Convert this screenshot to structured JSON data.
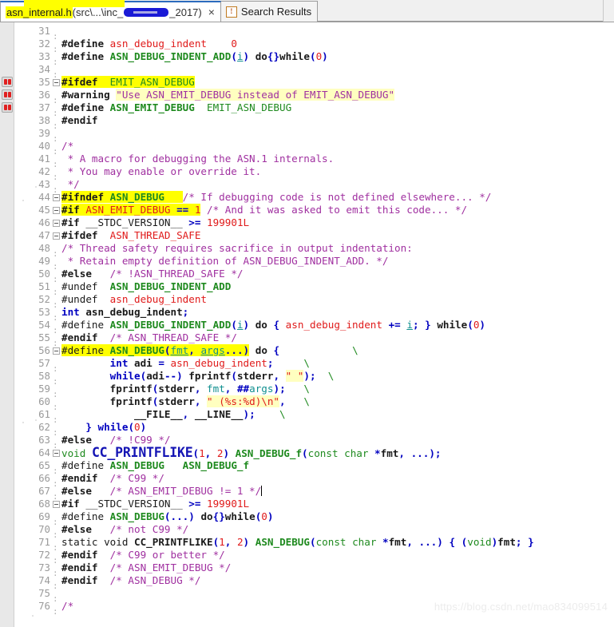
{
  "window": {
    "tabs": [
      {
        "name": "asn_internal.h",
        "path_prefix": "(src\\...\\inc_",
        "path_suffix": "_2017)",
        "close_label": "×",
        "active": true,
        "highlighted_name": true
      },
      {
        "name": "Search Results",
        "icon": "search-results-icon",
        "icon_glyph": "!",
        "active": false
      }
    ]
  },
  "editor": {
    "language": "c-header",
    "first_line": 31,
    "last_line": 76,
    "bookmark_lines": [
      35,
      36,
      37
    ],
    "fold_lines": [
      35,
      44,
      45,
      46,
      47,
      56,
      64,
      68
    ],
    "caret_line": 67,
    "lines": [
      {
        "n": 31,
        "text": ""
      },
      {
        "n": 32,
        "text": "#define asn_debug_indent    0"
      },
      {
        "n": 33,
        "text": "#define ASN_DEBUG_INDENT_ADD(i) do{}while(0)"
      },
      {
        "n": 34,
        "text": ""
      },
      {
        "n": 35,
        "text": "#ifdef  EMIT_ASN_DEBUG"
      },
      {
        "n": 36,
        "text": "#warning \"Use ASN_EMIT_DEBUG instead of EMIT_ASN_DEBUG\""
      },
      {
        "n": 37,
        "text": "#define ASN_EMIT_DEBUG  EMIT_ASN_DEBUG"
      },
      {
        "n": 38,
        "text": "#endif"
      },
      {
        "n": 39,
        "text": ""
      },
      {
        "n": 40,
        "text": "/*"
      },
      {
        "n": 41,
        "text": " * A macro for debugging the ASN.1 internals."
      },
      {
        "n": 42,
        "text": " * You may enable or override it."
      },
      {
        "n": 43,
        "text": " */"
      },
      {
        "n": 44,
        "text": "#ifndef ASN_DEBUG   /* If debugging code is not defined elsewhere... */"
      },
      {
        "n": 45,
        "text": "#if ASN_EMIT_DEBUG == 1 /* And it was asked to emit this code... */"
      },
      {
        "n": 46,
        "text": "#if __STDC_VERSION__ >= 199901L"
      },
      {
        "n": 47,
        "text": "#ifdef  ASN_THREAD_SAFE"
      },
      {
        "n": 48,
        "text": "/* Thread safety requires sacrifice in output indentation:"
      },
      {
        "n": 49,
        "text": " * Retain empty definition of ASN_DEBUG_INDENT_ADD. */"
      },
      {
        "n": 50,
        "text": "#else   /* !ASN_THREAD_SAFE */"
      },
      {
        "n": 51,
        "text": "#undef  ASN_DEBUG_INDENT_ADD"
      },
      {
        "n": 52,
        "text": "#undef  asn_debug_indent"
      },
      {
        "n": 53,
        "text": "int asn_debug_indent;"
      },
      {
        "n": 54,
        "text": "#define ASN_DEBUG_INDENT_ADD(i) do { asn_debug_indent += i; } while(0)"
      },
      {
        "n": 55,
        "text": "#endif  /* ASN_THREAD_SAFE */"
      },
      {
        "n": 56,
        "text": "#define ASN_DEBUG(fmt, args...) do {            \\"
      },
      {
        "n": 57,
        "text": "        int adi = asn_debug_indent;     \\"
      },
      {
        "n": 58,
        "text": "        while(adi--) fprintf(stderr, \" \");  \\"
      },
      {
        "n": 59,
        "text": "        fprintf(stderr, fmt, ##args);   \\"
      },
      {
        "n": 60,
        "text": "        fprintf(stderr, \" (%s:%d)\\n\",   \\"
      },
      {
        "n": 61,
        "text": "            __FILE__, __LINE__);    \\"
      },
      {
        "n": 62,
        "text": "    } while(0)"
      },
      {
        "n": 63,
        "text": "#else   /* !C99 */"
      },
      {
        "n": 64,
        "text": "void CC_PRINTFLIKE(1, 2) ASN_DEBUG_f(const char *fmt, ...);"
      },
      {
        "n": 65,
        "text": "#define ASN_DEBUG   ASN_DEBUG_f"
      },
      {
        "n": 66,
        "text": "#endif  /* C99 */"
      },
      {
        "n": 67,
        "text": "#else   /* ASN_EMIT_DEBUG != 1 */"
      },
      {
        "n": 68,
        "text": "#if __STDC_VERSION__ >= 199901L"
      },
      {
        "n": 69,
        "text": "#define ASN_DEBUG(...) do{}while(0)"
      },
      {
        "n": 70,
        "text": "#else   /* not C99 */"
      },
      {
        "n": 71,
        "text": "static void CC_PRINTFLIKE(1, 2) ASN_DEBUG(const char *fmt, ...) { (void)fmt; }"
      },
      {
        "n": 72,
        "text": "#endif  /* C99 or better */"
      },
      {
        "n": 73,
        "text": "#endif  /* ASN_EMIT_DEBUG */"
      },
      {
        "n": 74,
        "text": "#endif  /* ASN_DEBUG */"
      },
      {
        "n": 75,
        "text": ""
      },
      {
        "n": 76,
        "text": "/*"
      }
    ]
  },
  "watermark": {
    "text": "https://blog.csdn.net/mao834099514"
  },
  "colors": {
    "preprocessor": "#1a1a1a",
    "macro_green": "#1f8a1f",
    "identifier_red": "#e01b1b",
    "comment_purple": "#a030a0",
    "keyword_blue": "#0000c0",
    "param_teal": "#0f8f8f",
    "search_highlight": "#ffff00",
    "string_background": "#ffffc0",
    "tab_accent": "#2c6bbd"
  }
}
